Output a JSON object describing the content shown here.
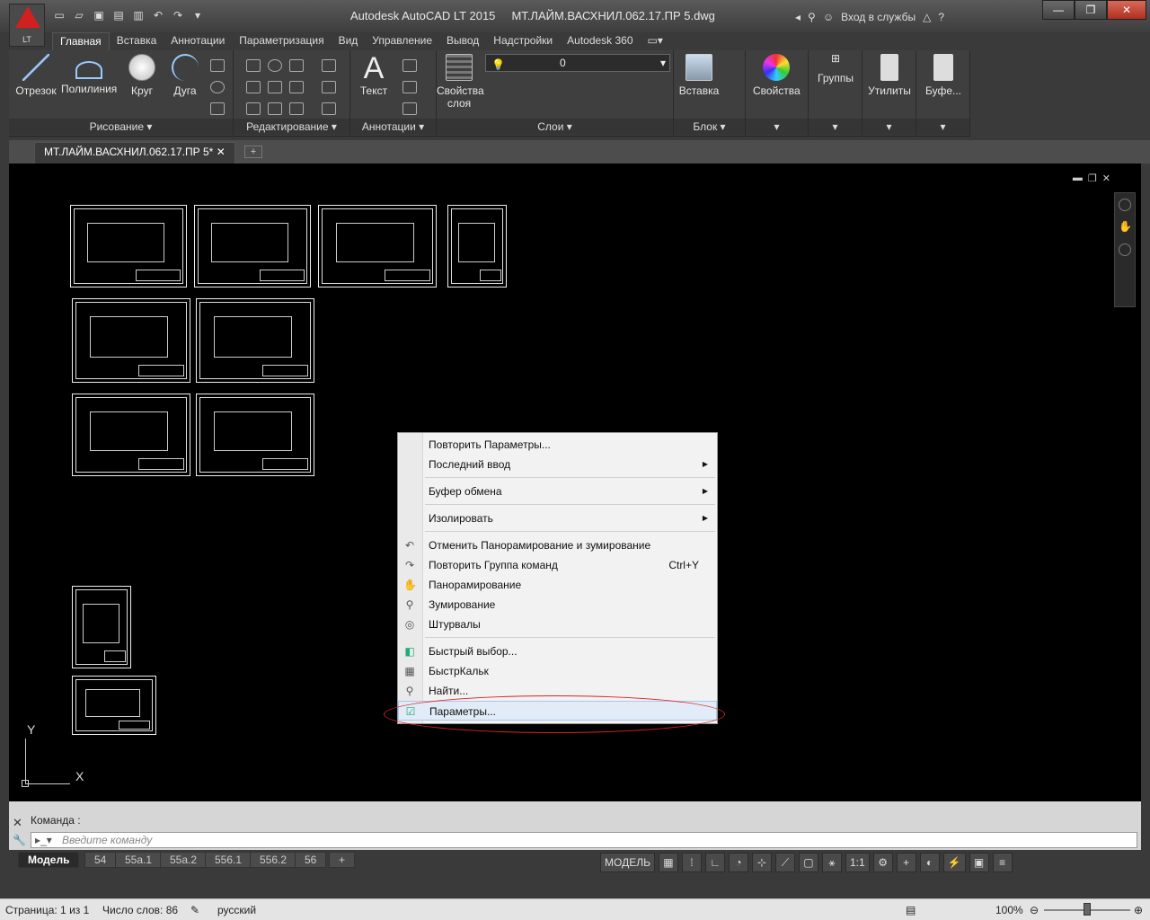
{
  "window": {
    "app_title": "Autodesk AutoCAD LT 2015",
    "file_title": "МТ.ЛАЙМ.ВАСХНИЛ.062.17.ПР 5.dwg",
    "logo_text": "LT",
    "signin": "Вход в службы",
    "help": "?"
  },
  "ribbon": {
    "tabs": [
      "Главная",
      "Вставка",
      "Аннотации",
      "Параметризация",
      "Вид",
      "Управление",
      "Вывод",
      "Надстройки",
      "Autodesk 360"
    ],
    "draw": {
      "line": "Отрезок",
      "polyline": "Полилиния",
      "circle": "Круг",
      "arc": "Дуга",
      "label": "Рисование"
    },
    "modify_label": "Редактирование",
    "annotation": {
      "text": "Текст",
      "label": "Аннотации"
    },
    "layers": {
      "props": "Свойства слоя",
      "current_layer": "0",
      "label": "Слои"
    },
    "block": {
      "insert": "Вставка",
      "label": "Блок"
    },
    "properties": "Свойства",
    "groups": "Группы",
    "utilities": "Утилиты",
    "clipboard": "Буфе..."
  },
  "file_tab": "МТ.ЛАЙМ.ВАСХНИЛ.062.17.ПР 5*",
  "file_tab_add": "+",
  "context_menu": {
    "repeat": "Повторить Параметры...",
    "recent_input": "Последний ввод",
    "clipboard": "Буфер обмена",
    "isolate": "Изолировать",
    "undo": "Отменить Панорамирование и зумирование",
    "redo": "Повторить Группа команд",
    "redo_shortcut": "Ctrl+Y",
    "pan": "Панорамирование",
    "zoom": "Зумирование",
    "steering": "Штурвалы",
    "quick_select": "Быстрый выбор...",
    "quickcalc": "БыстрКальк",
    "find": "Найти...",
    "options": "Параметры..."
  },
  "ucs": {
    "y": "Y",
    "x": "X"
  },
  "command": {
    "label": "Команда :",
    "placeholder": "Введите команду"
  },
  "layout_tabs": [
    "Модель",
    "54",
    "55а.1",
    "55а.2",
    "556.1",
    "556.2",
    "56",
    "+"
  ],
  "statusbar": {
    "model": "МОДЕЛЬ",
    "scale": "1:1"
  },
  "word": {
    "page": "Страница: 1 из 1",
    "words": "Число слов: 86",
    "lang": "русский",
    "zoom": "100%"
  },
  "colors": {
    "menu_highlight": "#e1ecf8",
    "annotation_circle": "#dd2222",
    "logo_red": "#d21f1f"
  }
}
